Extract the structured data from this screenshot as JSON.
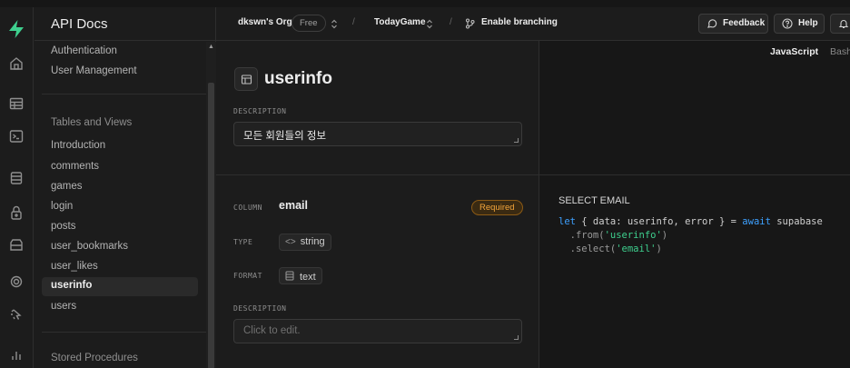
{
  "sidebar": {
    "title": "API Docs",
    "items_top": [
      "Authentication",
      "User Management"
    ],
    "group_label": "Tables and Views",
    "items": [
      "Introduction",
      "comments",
      "games",
      "login",
      "posts",
      "user_bookmarks",
      "user_likes",
      "userinfo",
      "users"
    ],
    "active_item": "userinfo",
    "stored_label": "Stored Procedures"
  },
  "topbar": {
    "org": "dkswn's Org",
    "plan": "Free",
    "sep": "/",
    "project": "TodayGame",
    "branch_label": "Enable branching",
    "feedback": "Feedback",
    "help": "Help"
  },
  "table": {
    "title": "userinfo",
    "desc_label": "DESCRIPTION",
    "description": "모든 회원들의 정보"
  },
  "column": {
    "col_label": "COLUMN",
    "name": "email",
    "required": "Required",
    "type_label": "TYPE",
    "type": "string",
    "format_label": "FORMAT",
    "format": "text",
    "desc_label": "DESCRIPTION",
    "desc_placeholder": "Click to edit."
  },
  "code": {
    "languages": [
      "JavaScript",
      "Bash"
    ],
    "active_language": "JavaScript",
    "title": "SELECT EMAIL",
    "line1": {
      "kw1": "let",
      "t1": " { data: userinfo, error } = ",
      "kw2": "await",
      "t2": " supabase"
    },
    "line2": {
      "a": "  .from(",
      "s": "'userinfo'",
      "b": ")"
    },
    "line3": {
      "a": "  .select(",
      "s": "'email'",
      "b": ")"
    }
  },
  "colors": {
    "brand": "#3ecf8e",
    "required": "#f3a53b",
    "keyword": "#3ea1ff"
  }
}
